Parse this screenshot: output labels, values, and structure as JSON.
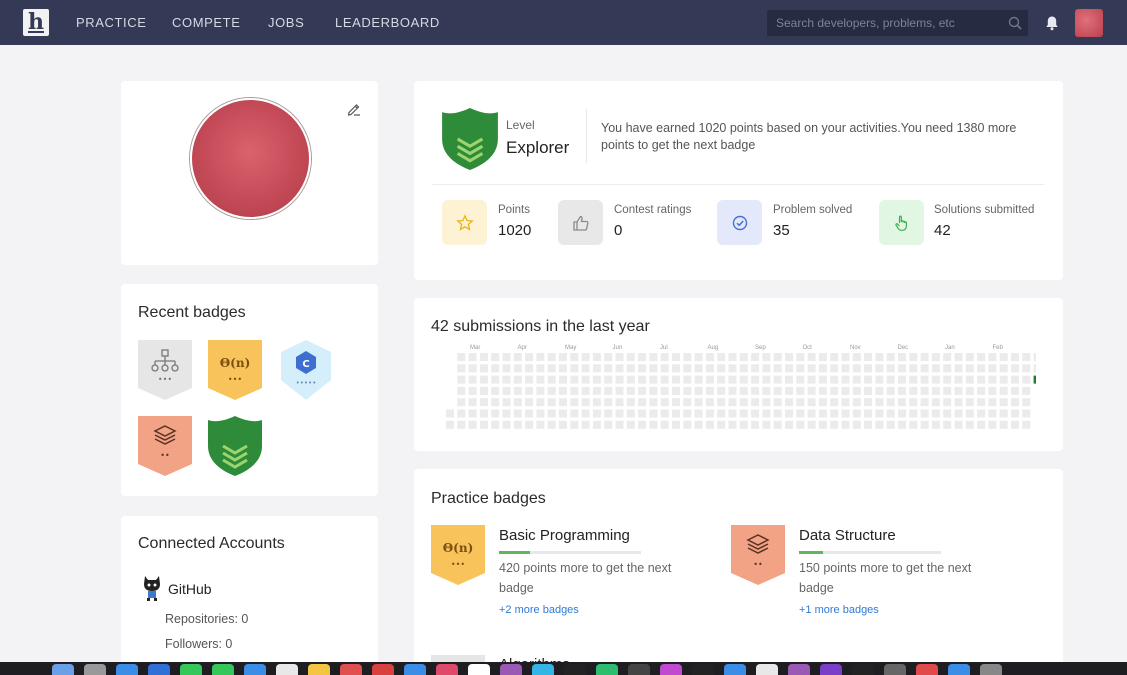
{
  "nav": {
    "items": [
      "PRACTICE",
      "COMPETE",
      "JOBS",
      "LEADERBOARD"
    ],
    "search_placeholder": "Search developers, problems, etc"
  },
  "recent_badges": {
    "title": "Recent badges",
    "items": [
      {
        "icon": "tree-structure-icon",
        "color": "#e6e6e6",
        "stars": "•••"
      },
      {
        "icon": "theta-n-icon",
        "label": "Θ(n)",
        "color": "#f8c35a",
        "stars": "•••"
      },
      {
        "icon": "c-language-icon",
        "color": "#d4eefb",
        "stars": "•••••"
      },
      {
        "icon": "layers-icon",
        "color": "#f2a386",
        "stars": "••"
      },
      {
        "icon": "chevrons-icon",
        "color": "#2e8b3a"
      }
    ]
  },
  "connected_accounts": {
    "title": "Connected Accounts",
    "github": {
      "name": "GitHub",
      "repositories": "Repositories: 0",
      "followers": "Followers: 0"
    }
  },
  "level": {
    "label": "Level",
    "value": "Explorer",
    "description": "You have earned 1020 points based on your activities.You need 1380 more points to get the next badge"
  },
  "stats": [
    {
      "label": "Points",
      "value": "1020",
      "icon": "star-icon",
      "bg": "#fdf3d4"
    },
    {
      "label": "Contest ratings",
      "value": "0",
      "icon": "thumbs-up-icon",
      "bg": "#e8e8e8"
    },
    {
      "label": "Problem solved",
      "value": "35",
      "icon": "check-circle-icon",
      "bg": "#e3e9fb"
    },
    {
      "label": "Solutions submitted",
      "value": "42",
      "icon": "hand-pointer-icon",
      "bg": "#e2f6e4"
    }
  ],
  "submissions": {
    "title": "42 submissions in the last year",
    "months": [
      "Mar",
      "Apr",
      "May",
      "Jun",
      "Jul",
      "Aug",
      "Sep",
      "Oct",
      "Nov",
      "Dec",
      "Jan",
      "Feb"
    ]
  },
  "practice_badges": {
    "title": "Practice badges",
    "items": [
      {
        "name": "Basic Programming",
        "desc": "420 points more to get the next badge",
        "more": "+2 more badges",
        "progress": 0.22
      },
      {
        "name": "Data Structure",
        "desc": "150 points more to get the next badge",
        "more": "+1 more badges",
        "progress": 0.17
      }
    ],
    "next_partial": "Algorithms"
  },
  "colors": {
    "nav_bg": "#343a56",
    "accent_green": "#2e8b3a",
    "link_blue": "#2f7ad8"
  }
}
